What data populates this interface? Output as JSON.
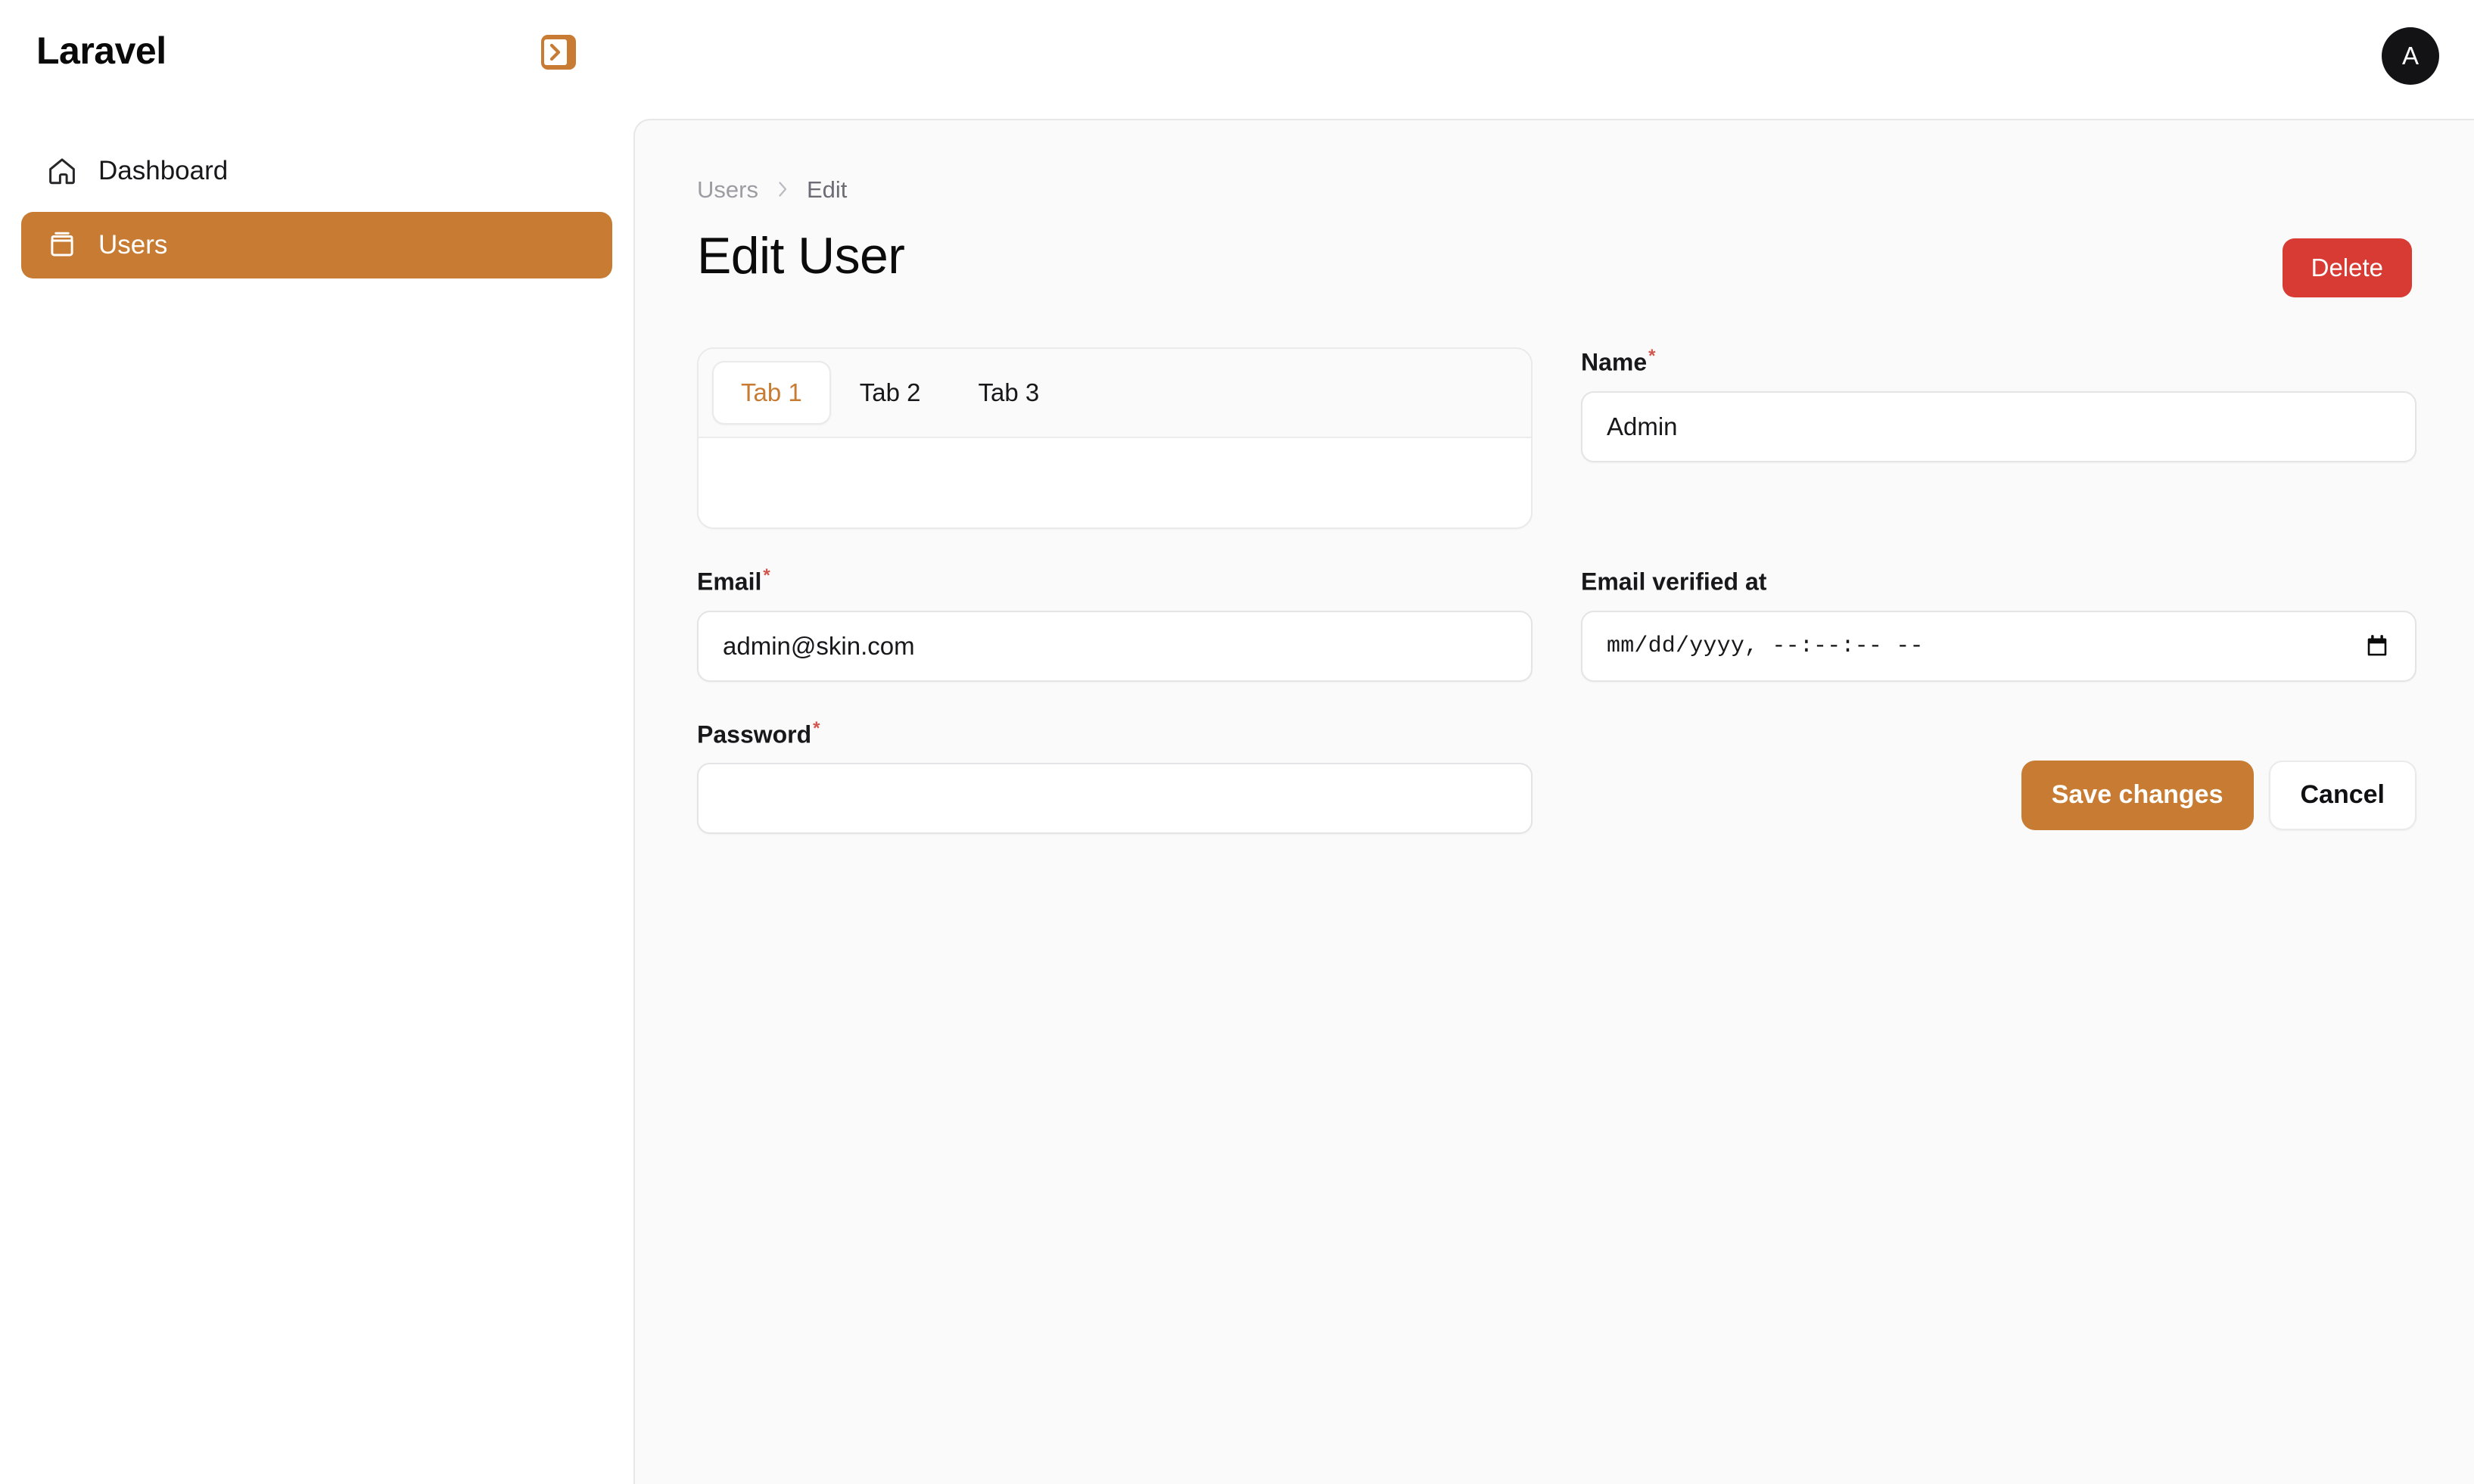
{
  "app": {
    "brand": "Laravel",
    "sidebar_toggle_icon": "chevron-right-panel-icon",
    "avatar_initial": "A"
  },
  "sidebar": {
    "items": [
      {
        "label": "Dashboard",
        "icon": "home-icon",
        "active": false
      },
      {
        "label": "Users",
        "icon": "archive-box-icon",
        "active": true
      }
    ]
  },
  "breadcrumb": {
    "parent": "Users",
    "separator": "chevron-right-icon",
    "current": "Edit"
  },
  "header": {
    "title": "Edit User",
    "delete_label": "Delete"
  },
  "tabs": {
    "items": [
      {
        "label": "Tab 1",
        "active": true
      },
      {
        "label": "Tab 2",
        "active": false
      },
      {
        "label": "Tab 3",
        "active": false
      }
    ]
  },
  "form": {
    "name": {
      "label": "Name",
      "required_marker": "*",
      "value": "Admin",
      "placeholder": ""
    },
    "email_verified_at": {
      "label": "Email verified at",
      "required_marker": "",
      "value": "",
      "placeholder": "mm/dd/yyyy, --:--:-- --",
      "icon": "calendar-icon"
    },
    "email": {
      "label": "Email",
      "required_marker": "*",
      "value": "admin@skin.com",
      "placeholder": ""
    },
    "password": {
      "label": "Password",
      "required_marker": "*",
      "value": "",
      "placeholder": ""
    }
  },
  "actions": {
    "save_label": "Save changes",
    "cancel_label": "Cancel"
  },
  "colors": {
    "accent": "#c87b32",
    "danger": "#d83b34",
    "required": "#d0564d",
    "avatar_bg": "#131316",
    "panel_bg": "#fafafa",
    "border": "#e4e4e7"
  }
}
